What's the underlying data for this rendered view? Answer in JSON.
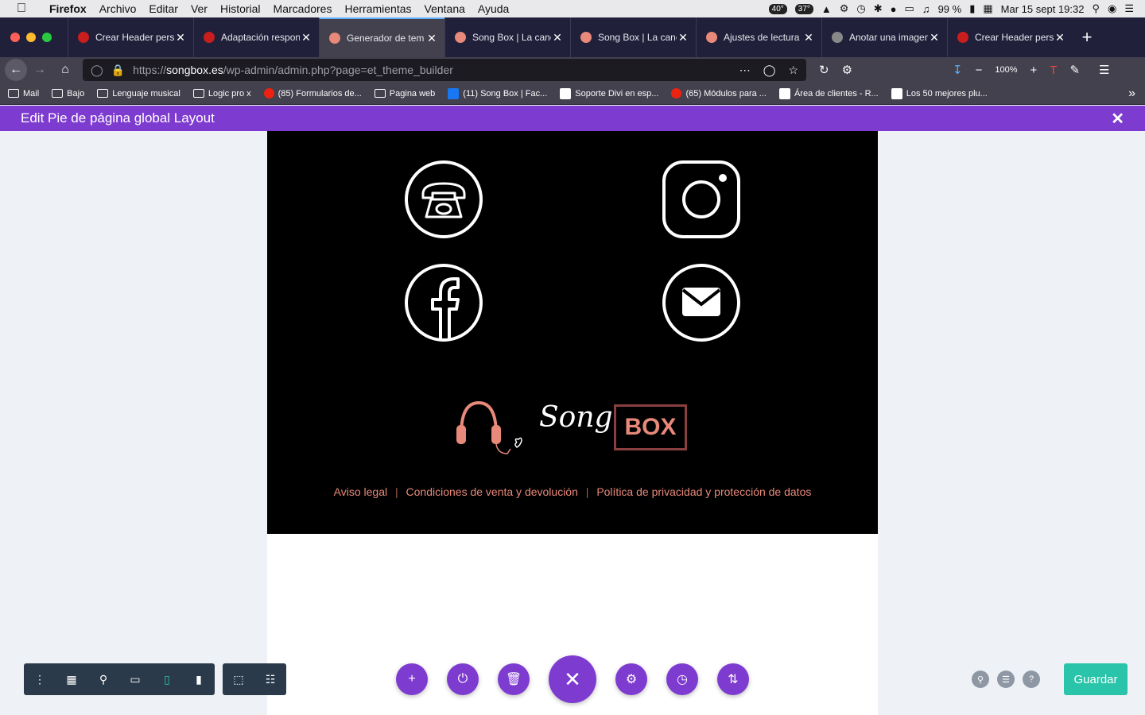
{
  "menubar": {
    "app": "Firefox",
    "items": [
      "Archivo",
      "Editar",
      "Ver",
      "Historial",
      "Marcadores",
      "Herramientas",
      "Ventana",
      "Ayuda"
    ],
    "temp1": "40°",
    "temp2": "37°",
    "battery": "99 %",
    "datetime": "Mar 15 sept  19:32"
  },
  "tabs": [
    {
      "title": "Crear Header pers",
      "color": "#c81e1e",
      "active": false
    },
    {
      "title": "Adaptación respon",
      "color": "#c81e1e",
      "active": false
    },
    {
      "title": "Generador de tem",
      "color": "#e8897a",
      "active": true
    },
    {
      "title": "Song Box | La canc",
      "color": "#e8897a",
      "active": false
    },
    {
      "title": "Song Box | La canc",
      "color": "#e8897a",
      "active": false
    },
    {
      "title": "Ajustes de lectura",
      "color": "#e8897a",
      "active": false
    },
    {
      "title": "Anotar una imagen",
      "color": "#888888",
      "active": false
    },
    {
      "title": "Crear Header pers",
      "color": "#c81e1e",
      "active": false
    }
  ],
  "nav": {
    "url_prefix": "https://",
    "url_host": "songbox.es",
    "url_path": "/wp-admin/admin.php?page=et_theme_builder",
    "zoom": "100%"
  },
  "bookmarks": [
    {
      "label": "Mail",
      "icon": "folder"
    },
    {
      "label": "Bajo",
      "icon": "folder"
    },
    {
      "label": "Lenguaje musical",
      "icon": "folder"
    },
    {
      "label": "Logic pro x",
      "icon": "folder"
    },
    {
      "label": "(85) Formularios de...",
      "icon": "yt"
    },
    {
      "label": "Pagina web",
      "icon": "folder"
    },
    {
      "label": "(11) Song Box | Fac...",
      "icon": "fb"
    },
    {
      "label": "Soporte Divi en esp...",
      "icon": "w"
    },
    {
      "label": "(65) Módulos para ...",
      "icon": "yt"
    },
    {
      "label": "Área de clientes - R...",
      "icon": "w"
    },
    {
      "label": "Los 50 mejores plu...",
      "icon": "w"
    }
  ],
  "editbar": {
    "title": "Edit Pie de página global Layout"
  },
  "footer": {
    "logo_song": "Song",
    "logo_box": "BOX",
    "links": [
      "Aviso legal",
      "Condiciones de venta y devolución",
      "Política de privacidad y protección de datos"
    ],
    "link_separator": "|"
  },
  "colors": {
    "accent": "#7e3bd0",
    "save": "#29c4a9",
    "brand": "#e8897a"
  },
  "actions": {
    "save_label": "Guardar"
  }
}
